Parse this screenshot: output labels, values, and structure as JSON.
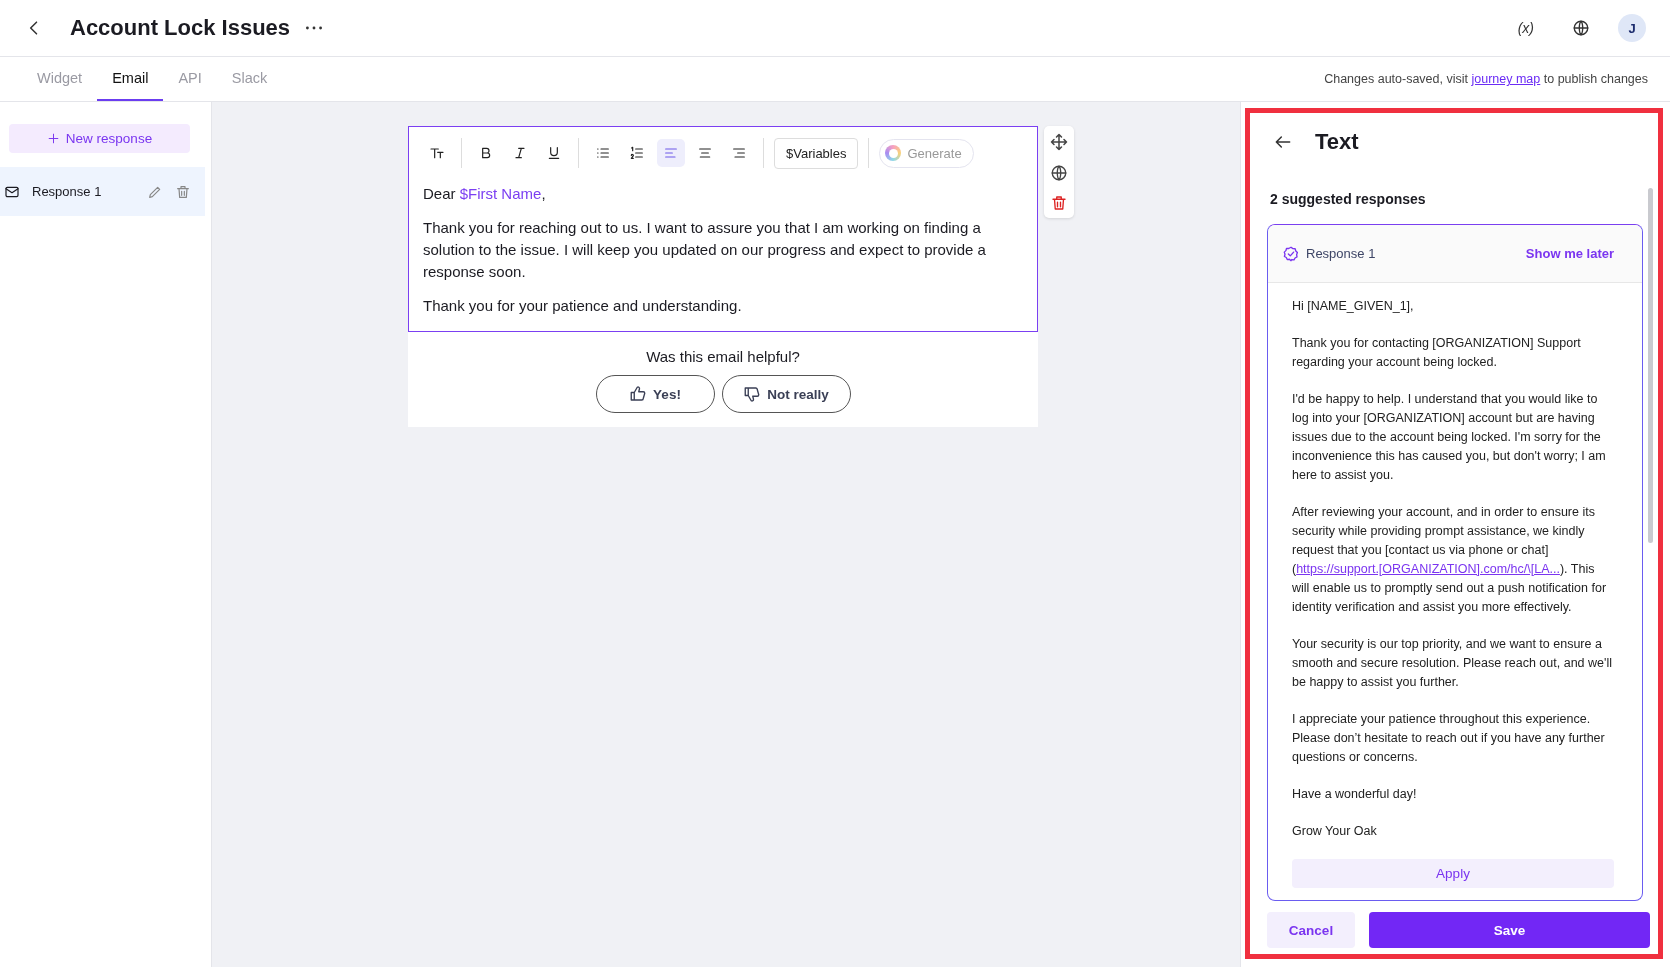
{
  "header": {
    "title": "Account Lock Issues",
    "variables_label": "(x)",
    "avatar": "J"
  },
  "tabs": [
    {
      "label": "Widget",
      "selected": false
    },
    {
      "label": "Email",
      "selected": true
    },
    {
      "label": "API",
      "selected": false
    },
    {
      "label": "Slack",
      "selected": false
    }
  ],
  "autosave_note": {
    "before": "Changes auto-saved, visit ",
    "link": "journey map",
    "after": " to publish changes"
  },
  "sidebar": {
    "new_button": "New response",
    "items": [
      {
        "label": "Response 1",
        "selected": true
      }
    ]
  },
  "toolbar": [
    {
      "kind": "text-size",
      "selected": false
    },
    {
      "kind": "bold",
      "selected": false
    },
    {
      "kind": "italic",
      "selected": false
    },
    {
      "kind": "underline",
      "selected": false
    },
    {
      "kind": "bullet-list",
      "selected": false
    },
    {
      "kind": "numbered-list",
      "selected": false
    },
    {
      "kind": "align-left",
      "selected": true
    },
    {
      "kind": "align-center",
      "selected": false
    },
    {
      "kind": "align-right",
      "selected": false
    }
  ],
  "variables_button": "$Variables",
  "generate_button": {
    "label": "Generate",
    "disabled": true
  },
  "editor": {
    "greeting": {
      "before": "Dear ",
      "variable": "$First Name",
      "after": ","
    },
    "paragraphs": [
      "Thank you for reaching out to us. I want to assure you that I am working on finding a solution to the issue. I will keep you updated on our progress and expect to provide a response soon.",
      "Thank you for your patience and understanding."
    ]
  },
  "feedback": {
    "question": "Was this email helpful?",
    "yes": "Yes!",
    "no": "Not really"
  },
  "panel": {
    "title": "Text",
    "subtitle": "2 suggested responses",
    "card": {
      "title": "Response 1",
      "action": "Show me later",
      "paragraphs": [
        {
          "text": "Hi [NAME_GIVEN_1],"
        },
        {
          "text": "Thank you for contacting [ORGANIZATION] Support regarding your account being locked."
        },
        {
          "text": "I'd be happy to help. I understand that you would like to log into your [ORGANIZATION] account but are having issues due to the account being locked. I'm sorry for the inconvenience this has caused you, but don't worry; I am here to assist you."
        },
        {
          "text": "After reviewing your account, and in order to ensure its security while providing prompt assistance, we kindly request that you [contact us via phone or chat] (",
          "link": "https://support.[ORGANIZATION].com/hc/\\[LA...",
          "after": "). This will enable us to promptly send out a push notification for identity verification and assist you more effectively."
        },
        {
          "text": "Your security is our top priority, and we want to ensure a smooth and secure resolution. Please reach out, and we'll be happy to assist you further."
        },
        {
          "text": "I appreciate your patience throughout this experience. Please don’t hesitate to reach out if you have any further questions or concerns."
        },
        {
          "text": "Have a wonderful day!"
        },
        {
          "text": "Grow Your Oak"
        }
      ],
      "apply": "Apply"
    },
    "cancel": "Cancel",
    "save": "Save"
  }
}
